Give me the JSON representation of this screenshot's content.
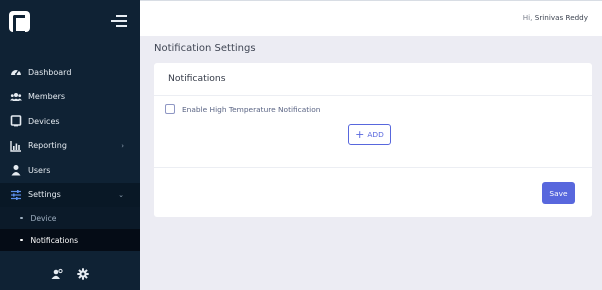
{
  "header": {
    "greeting_prefix": "Hi,",
    "user_name": "Srinivas Reddy"
  },
  "sidebar": {
    "items": [
      {
        "label": "Dashboard",
        "icon": "speedometer-icon"
      },
      {
        "label": "Members",
        "icon": "users-icon"
      },
      {
        "label": "Devices",
        "icon": "tablet-icon"
      },
      {
        "label": "Reporting",
        "icon": "chart-icon",
        "chevron": "›"
      },
      {
        "label": "Users",
        "icon": "user-icon"
      },
      {
        "label": "Settings",
        "icon": "sliders-icon",
        "chevron": "⌄"
      }
    ],
    "sub_items": [
      {
        "label": "Device"
      },
      {
        "label": "Notifications"
      }
    ],
    "footer_icons": [
      "user-settings-icon",
      "gear-icon"
    ]
  },
  "main": {
    "page_title": "Notification Settings",
    "card_title": "Notifications",
    "checkbox_label": "Enable High Temperature Notification",
    "add_label": "ADD",
    "save_label": "Save"
  },
  "colors": {
    "sidebar": "#0f2234",
    "accent": "#5867dd",
    "background": "#ececf3"
  }
}
